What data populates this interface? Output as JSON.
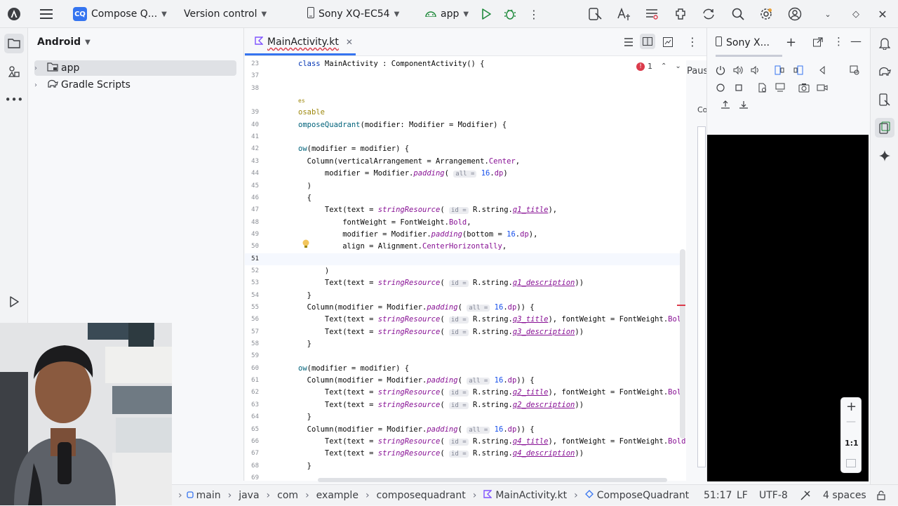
{
  "topbar": {
    "project_badge": "CQ",
    "project_name": "Compose Q...",
    "vcs": "Version control",
    "device": "Sony XQ-EC54",
    "run_config": "app"
  },
  "project_panel": {
    "title": "Android",
    "items": [
      {
        "label": "app"
      },
      {
        "label": "Gradle Scripts"
      }
    ]
  },
  "editor": {
    "tab_label": "MainActivity.kt",
    "error_count": "1",
    "lines": [
      {
        "n": "23",
        "html": "<span class=\"kw\">class</span> MainActivity : ComponentActivity() {"
      },
      {
        "n": "37",
        "html": ""
      },
      {
        "n": "38",
        "html": ""
      },
      {
        "n": "",
        "html": "<span class=\"ann\" style=\"font-size:8px\">es</span>"
      },
      {
        "n": "39",
        "html": "<span class=\"ann\">osable</span>"
      },
      {
        "n": "40",
        "html": "<span class=\"fn\">omposeQuadrant</span>(modifier: Modifier = Modifier) {"
      },
      {
        "n": "41",
        "html": ""
      },
      {
        "n": "42",
        "html": "<span class=\"fn\">ow</span>(modifier = modifier) {"
      },
      {
        "n": "43",
        "html": "  Column(verticalArrangement = Arrangement.<span class=\"prop\">Center</span>,"
      },
      {
        "n": "44",
        "html": "      modifier = Modifier.<span class=\"it\">padding</span>( <span class=\"hint\">all =</span> <span class=\"num\">16</span>.<span class=\"prop\">dp</span>)"
      },
      {
        "n": "45",
        "html": "  )"
      },
      {
        "n": "46",
        "html": "  {"
      },
      {
        "n": "47",
        "html": "      Text(text = <span class=\"it\">stringResource</span>( <span class=\"hint\">id =</span> R.string.<span class=\"str\">q1_title</span>),"
      },
      {
        "n": "48",
        "html": "          fontWeight = FontWeight.<span class=\"prop\">Bold</span>,"
      },
      {
        "n": "49",
        "html": "          modifier = Modifier.<span class=\"it\">padding</span>(bottom = <span class=\"num\">16</span>.<span class=\"prop\">dp</span>),"
      },
      {
        "n": "50",
        "html": "          align = Alignment.<span class=\"prop\">CenterHorizontally</span>,"
      },
      {
        "n": "51",
        "html": ""
      },
      {
        "n": "52",
        "html": "      )"
      },
      {
        "n": "53",
        "html": "      Text(text = <span class=\"it\">stringResource</span>( <span class=\"hint\">id =</span> R.string.<span class=\"str\">q1_description</span>))"
      },
      {
        "n": "54",
        "html": "  }"
      },
      {
        "n": "55",
        "html": "  Column(modifier = Modifier.<span class=\"it\">padding</span>( <span class=\"hint\">all =</span> <span class=\"num\">16</span>.<span class=\"prop\">dp</span>)) {"
      },
      {
        "n": "56",
        "html": "      Text(text = <span class=\"it\">stringResource</span>( <span class=\"hint\">id =</span> R.string.<span class=\"str\">q3_title</span>), fontWeight = FontWeight.<span class=\"prop\">Bold</span>)"
      },
      {
        "n": "57",
        "html": "      Text(text = <span class=\"it\">stringResource</span>( <span class=\"hint\">id =</span> R.string.<span class=\"str\">q3_description</span>))"
      },
      {
        "n": "58",
        "html": "  }"
      },
      {
        "n": "59",
        "html": ""
      },
      {
        "n": "60",
        "html": "<span class=\"fn\">ow</span>(modifier = modifier) {"
      },
      {
        "n": "61",
        "html": "  Column(modifier = Modifier.<span class=\"it\">padding</span>( <span class=\"hint\">all =</span> <span class=\"num\">16</span>.<span class=\"prop\">dp</span>)) {"
      },
      {
        "n": "62",
        "html": "      Text(text = <span class=\"it\">stringResource</span>( <span class=\"hint\">id =</span> R.string.<span class=\"str\">q2_title</span>), fontWeight = FontWeight.<span class=\"prop\">Bold</span>)"
      },
      {
        "n": "63",
        "html": "      Text(text = <span class=\"it\">stringResource</span>( <span class=\"hint\">id =</span> R.string.<span class=\"str\">q2_description</span>))"
      },
      {
        "n": "64",
        "html": "  }"
      },
      {
        "n": "65",
        "html": "  Column(modifier = Modifier.<span class=\"it\">padding</span>( <span class=\"hint\">all =</span> <span class=\"num\">16</span>.<span class=\"prop\">dp</span>)) {"
      },
      {
        "n": "66",
        "html": "      Text(text = <span class=\"it\">stringResource</span>( <span class=\"hint\">id =</span> R.string.<span class=\"str\">q4_title</span>), fontWeight = FontWeight.<span class=\"prop\">Bold</span>)"
      },
      {
        "n": "67",
        "html": "      Text(text = <span class=\"it\">stringResource</span>( <span class=\"hint\">id =</span> R.string.<span class=\"str\">q4_description</span>))"
      },
      {
        "n": "68",
        "html": "  }"
      },
      {
        "n": "69",
        "html": ""
      }
    ]
  },
  "device_panel": {
    "tab_label": "Sony X...",
    "zoom_label": "1:1",
    "paused_label": "Paus",
    "cut_label": "Co"
  },
  "statusbar": {
    "breadcrumb": [
      "main",
      "java",
      "com",
      "example",
      "composequadrant",
      "MainActivity.kt",
      "ComposeQuadrant"
    ],
    "position": "51:17",
    "line_sep": "LF",
    "encoding": "UTF-8",
    "indent": "4 spaces"
  },
  "colors": {
    "accent": "#3574f0",
    "error": "#db3b4b",
    "run_green": "#208a3c"
  }
}
